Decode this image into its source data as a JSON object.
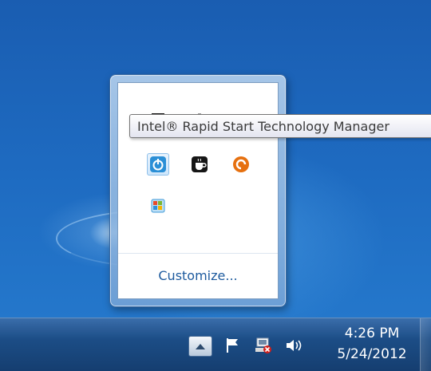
{
  "tooltip": {
    "text": "Intel® Rapid Start Technology Manager"
  },
  "flyout": {
    "customize_label": "Customize...",
    "icons": [
      {
        "name": "black-square-app-icon",
        "color": "#111111"
      },
      {
        "name": "gray-pen-app-icon",
        "color": "#8a8a8a"
      },
      {
        "name": "gray-device-app-icon",
        "color": "#8a8a8a"
      },
      {
        "name": "intel-rapid-start-power-icon",
        "color": "#2b8fd6"
      },
      {
        "name": "coffee-cup-app-icon",
        "color": "#111111"
      },
      {
        "name": "orange-circle-arrow-icon",
        "color": "#e6700f"
      },
      {
        "name": "windows-update-icon",
        "color": "#3f9ad8"
      }
    ]
  },
  "taskbar": {
    "icons": [
      "show-hidden-icons-arrow",
      "action-center-flag-icon",
      "network-disconnected-icon",
      "volume-speaker-icon"
    ],
    "clock": {
      "time": "4:26 PM",
      "date": "5/24/2012"
    }
  }
}
